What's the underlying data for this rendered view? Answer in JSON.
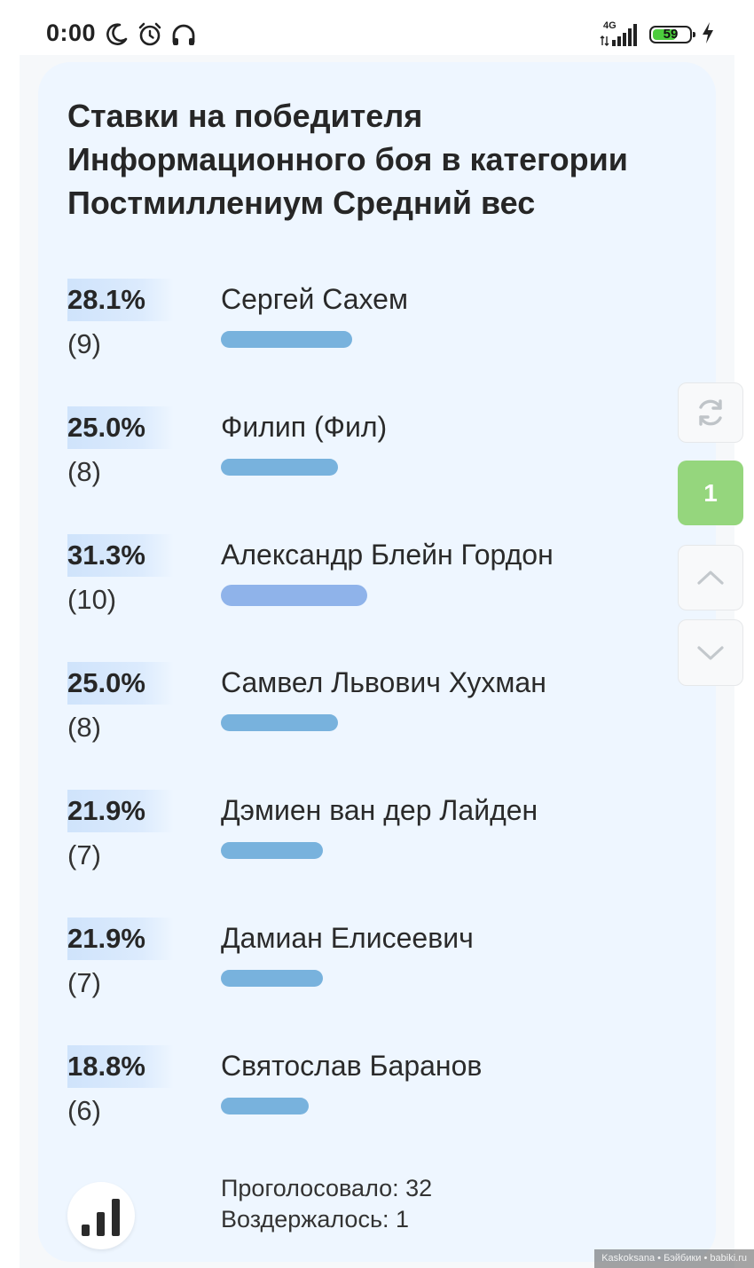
{
  "status_bar": {
    "time": "0:00",
    "network_label": "4G",
    "battery_level": "59",
    "icons": [
      "moon-icon",
      "alarm-icon",
      "headphones-icon",
      "signal-icon",
      "battery-icon",
      "charging-bolt-icon"
    ]
  },
  "poll": {
    "title": "Ставки на победителя Информационного боя в категории Постмиллениум Средний вес",
    "options": [
      {
        "percent": "28.1%",
        "count": "(9)",
        "name": "Сергей Сахем",
        "share": 0.281
      },
      {
        "percent": "25.0%",
        "count": "(8)",
        "name": "Филип (Фил)",
        "share": 0.25
      },
      {
        "percent": "31.3%",
        "count": "(10)",
        "name": "Александр Блейн Гордон",
        "share": 0.313,
        "leader": true
      },
      {
        "percent": "25.0%",
        "count": "(8)",
        "name": "Самвел Львович Хухман",
        "share": 0.25
      },
      {
        "percent": "21.9%",
        "count": "(7)",
        "name": "Дэмиен ван дер Лайден",
        "share": 0.219
      },
      {
        "percent": "21.9%",
        "count": "(7)",
        "name": "Дамиан Елисеевич",
        "share": 0.219
      },
      {
        "percent": "18.8%",
        "count": "(6)",
        "name": "Святослав Баранов",
        "share": 0.188
      }
    ],
    "voted": "Проголосовало: 32",
    "abstained": "Воздержалось: 1"
  },
  "side_controls": {
    "page_number": "1",
    "icons": [
      "refresh-icon",
      "chevron-up-icon",
      "chevron-down-icon"
    ]
  },
  "watermark": "Kaskoksana • Бэйбики • babiki.ru",
  "colors": {
    "card_bg": "#eef6ff",
    "bar": "#78b2dd",
    "leader_bar": "#8fb3ea",
    "page_badge": "#95d67d",
    "battery_fill": "#4ccd3d"
  }
}
